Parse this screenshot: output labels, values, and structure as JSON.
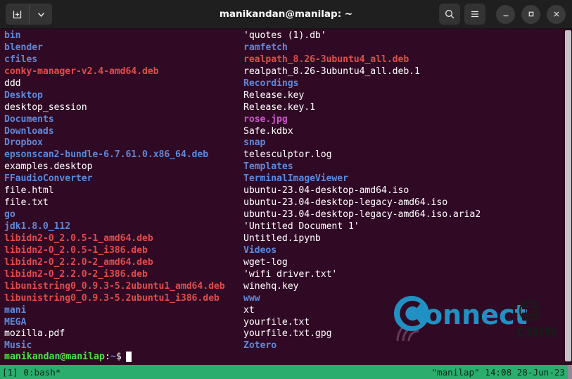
{
  "window": {
    "title": "manikandan@manilap: ~",
    "background": "#300a24",
    "titlebar_background": "#1f1f1f",
    "controls": {
      "new_tab": "new-tab",
      "tab_dropdown": "chevron-down",
      "search": "search",
      "menu": "hamburger-menu",
      "minimize": "–",
      "maximize": "□",
      "close": "✕"
    }
  },
  "terminal": {
    "colors": {
      "directory": "#5f87d7",
      "archive": "#e04b4b",
      "image": "#cc55cc",
      "plain": "#ffffff",
      "prompt_user": "#4fe04f",
      "prompt_path": "#5f87d7"
    },
    "left_column": [
      {
        "name": "bin",
        "type": "dir"
      },
      {
        "name": "blender",
        "type": "dir"
      },
      {
        "name": "cfiles",
        "type": "dir"
      },
      {
        "name": "conky-manager-v2.4-amd64.deb",
        "type": "archive"
      },
      {
        "name": "ddd",
        "type": "plain"
      },
      {
        "name": "Desktop",
        "type": "dir"
      },
      {
        "name": "desktop_session",
        "type": "plain"
      },
      {
        "name": "Documents",
        "type": "dir"
      },
      {
        "name": "Downloads",
        "type": "dir"
      },
      {
        "name": "Dropbox",
        "type": "dir"
      },
      {
        "name": "epsonscan2-bundle-6.7.61.0.x86_64.deb",
        "type": "dir"
      },
      {
        "name": "examples.desktop",
        "type": "plain"
      },
      {
        "name": "FFaudioConverter",
        "type": "dir"
      },
      {
        "name": "file.html",
        "type": "plain"
      },
      {
        "name": "file.txt",
        "type": "plain"
      },
      {
        "name": "go",
        "type": "dir"
      },
      {
        "name": "jdk1.8.0_112",
        "type": "dir"
      },
      {
        "name": "libidn2-0_2.0.5-1_amd64.deb",
        "type": "archive"
      },
      {
        "name": "libidn2-0_2.0.5-1_i386.deb",
        "type": "archive"
      },
      {
        "name": "libidn2-0_2.2.0-2_amd64.deb",
        "type": "archive"
      },
      {
        "name": "libidn2-0_2.2.0-2_i386.deb",
        "type": "archive"
      },
      {
        "name": "libunistring0_0.9.3-5.2ubuntu1_amd64.deb",
        "type": "archive"
      },
      {
        "name": "libunistring0_0.9.3-5.2ubuntu1_i386.deb",
        "type": "archive"
      },
      {
        "name": "mani",
        "type": "dir"
      },
      {
        "name": "MEGA",
        "type": "dir"
      },
      {
        "name": "mozilla.pdf",
        "type": "plain"
      },
      {
        "name": "Music",
        "type": "dir"
      }
    ],
    "right_column": [
      {
        "name": "'quotes (1).db'",
        "type": "plain"
      },
      {
        "name": "ramfetch",
        "type": "dir"
      },
      {
        "name": "realpath_8.26-3ubuntu4_all.deb",
        "type": "archive"
      },
      {
        "name": "realpath_8.26-3ubuntu4_all.deb.1",
        "type": "plain"
      },
      {
        "name": "Recordings",
        "type": "dir"
      },
      {
        "name": "Release.key",
        "type": "plain"
      },
      {
        "name": "Release.key.1",
        "type": "plain"
      },
      {
        "name": "rose.jpg",
        "type": "image"
      },
      {
        "name": "Safe.kdbx",
        "type": "plain"
      },
      {
        "name": "snap",
        "type": "dir"
      },
      {
        "name": "telesculptor.log",
        "type": "plain"
      },
      {
        "name": "Templates",
        "type": "dir"
      },
      {
        "name": "TerminalImageViewer",
        "type": "dir"
      },
      {
        "name": "ubuntu-23.04-desktop-amd64.iso",
        "type": "plain"
      },
      {
        "name": "ubuntu-23.04-desktop-legacy-amd64.iso",
        "type": "plain"
      },
      {
        "name": "ubuntu-23.04-desktop-legacy-amd64.iso.aria2",
        "type": "plain"
      },
      {
        "name": "'Untitled Document 1'",
        "type": "plain"
      },
      {
        "name": "Untitled.ipynb",
        "type": "plain"
      },
      {
        "name": "Videos",
        "type": "dir"
      },
      {
        "name": "wget-log",
        "type": "plain"
      },
      {
        "name": "'wifi driver.txt'",
        "type": "plain"
      },
      {
        "name": "winehq.key",
        "type": "plain"
      },
      {
        "name": "www",
        "type": "dir"
      },
      {
        "name": "xt",
        "type": "plain"
      },
      {
        "name": "yourfile.txt",
        "type": "plain"
      },
      {
        "name": "yourfile.txt.gpg",
        "type": "plain"
      },
      {
        "name": "Zotero",
        "type": "dir"
      }
    ],
    "prompt": {
      "user_host": "manikandan@manilap",
      "colon": ":",
      "path": "~",
      "symbol": "$",
      "input": ""
    }
  },
  "watermark": {
    "brand": "onnect",
    "initial": "C",
    "suffix": "com"
  },
  "status_bar": {
    "left": "[1] 0:bash*",
    "right": "\"manilap\" 14:08 28-Jun-23",
    "background": "#2bad6e"
  }
}
